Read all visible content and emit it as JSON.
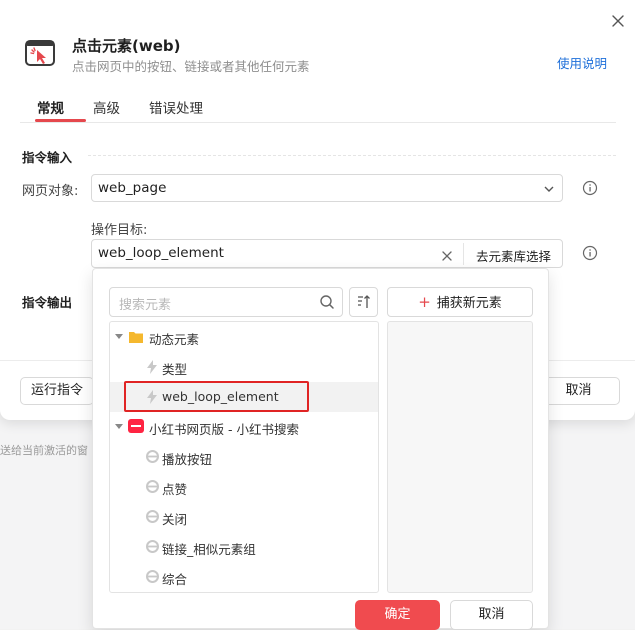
{
  "header": {
    "title": "点击元素(web)",
    "subtitle": "点击网页中的按钮、链接或者其他任何元素",
    "help_link": "使用说明",
    "icon": "click-cursor-icon"
  },
  "tabs": [
    {
      "label": "常规",
      "active": true
    },
    {
      "label": "高级",
      "active": false
    },
    {
      "label": "错误处理",
      "active": false
    }
  ],
  "input_section": {
    "title": "指令输入",
    "page_object_label": "网页对象:",
    "page_object_value": "web_page",
    "target_label": "操作目标:",
    "target_value": "web_loop_element",
    "library_button": "去元素库选择"
  },
  "output_section": {
    "title": "指令输出"
  },
  "footer": {
    "run_button": "运行指令",
    "cancel_button": "取消"
  },
  "background": {
    "hint_text": "送给当前激活的窗"
  },
  "dropdown": {
    "search_placeholder": "搜索元素",
    "capture_button": "捕获新元素",
    "tree": [
      {
        "type": "folder",
        "label": "动态元素",
        "expanded": true,
        "level": 0,
        "icon": "folder-icon"
      },
      {
        "type": "item",
        "label": "类型",
        "level": 1,
        "icon": "lightning-icon"
      },
      {
        "type": "item",
        "label": "web_loop_element",
        "level": 1,
        "icon": "lightning-icon",
        "selected": true
      },
      {
        "type": "group",
        "label": "小红书网页版 - 小红书搜索",
        "expanded": true,
        "level": 0,
        "icon": "xiaohongshu-icon"
      },
      {
        "type": "item",
        "label": "播放按钮",
        "level": 1,
        "icon": "browser-e-icon"
      },
      {
        "type": "item",
        "label": "点赞",
        "level": 1,
        "icon": "browser-e-icon"
      },
      {
        "type": "item",
        "label": "关闭",
        "level": 1,
        "icon": "browser-e-icon"
      },
      {
        "type": "item",
        "label": "链接_相似元素组",
        "level": 1,
        "icon": "browser-e-icon"
      },
      {
        "type": "item",
        "label": "综合",
        "level": 1,
        "icon": "browser-e-icon"
      }
    ],
    "ok_button": "确定",
    "cancel_button": "取消"
  },
  "colors": {
    "accent": "#e5484d",
    "link": "#1e6fd9",
    "selection_outline": "#e02424"
  }
}
